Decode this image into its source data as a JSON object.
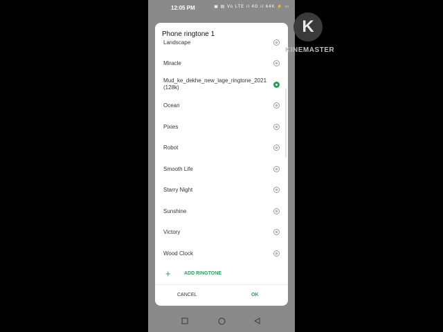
{
  "status": {
    "time": "12:05 PM",
    "icons_text": "▣ ▤ Vo LTE ıl 4G ıl 64K ⚡ ▭"
  },
  "dialog": {
    "title": "Phone ringtone 1",
    "ringtones": [
      {
        "label": "Landscape",
        "selected": false
      },
      {
        "label": "Miracle",
        "selected": false
      },
      {
        "label": "Mud_ke_dekhe_new_lage_ringtone_2021(128k)",
        "selected": true
      },
      {
        "label": "Ocean",
        "selected": false
      },
      {
        "label": "Pixies",
        "selected": false
      },
      {
        "label": "Robot",
        "selected": false
      },
      {
        "label": "Smooth Life",
        "selected": false
      },
      {
        "label": "Starry Night",
        "selected": false
      },
      {
        "label": "Sunshine",
        "selected": false
      },
      {
        "label": "Victory",
        "selected": false
      },
      {
        "label": "Wood Clock",
        "selected": false
      }
    ],
    "add_ringtone_label": "ADD RINGTONE",
    "cancel_label": "CANCEL",
    "ok_label": "OK",
    "accent_color": "#2a9b59"
  },
  "navbar": {
    "recents_icon": "square-icon",
    "home_icon": "circle-icon",
    "back_icon": "triangle-back-icon"
  },
  "watermark": {
    "logo_letter": "K",
    "text": "KINEMASTER"
  }
}
